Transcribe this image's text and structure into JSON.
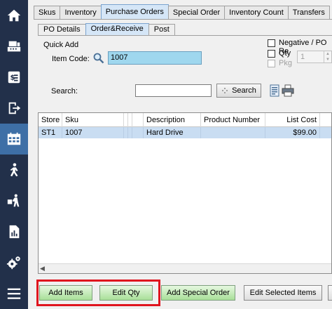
{
  "nav": {
    "items": [
      {
        "icon": "home-icon"
      },
      {
        "icon": "register-icon"
      },
      {
        "icon": "invoice-icon"
      },
      {
        "icon": "sign-out-icon"
      },
      {
        "icon": "calendar-grid-icon",
        "active": true
      },
      {
        "icon": "person-walking-icon"
      },
      {
        "icon": "delivery-icon"
      },
      {
        "icon": "report-icon"
      },
      {
        "icon": "settings-icon"
      },
      {
        "icon": "menu-icon"
      }
    ]
  },
  "tabs": [
    "Skus",
    "Inventory",
    "Purchase Orders",
    "Special Order",
    "Inventory Count",
    "Transfers"
  ],
  "active_tab": "Purchase Orders",
  "subtabs": [
    "PO Details",
    "Order&Receive",
    "Post"
  ],
  "active_subtab": "Order&Receive",
  "quick_add": {
    "title": "Quick Add",
    "item_code_label": "Item Code:",
    "item_code_value": "1007",
    "negative_label": "Negative / PO Re",
    "qty_label": "Qty",
    "pkg_label": "Pkg",
    "qty_value": "1"
  },
  "search": {
    "label": "Search:",
    "value": "",
    "button_label": "Search"
  },
  "grid": {
    "columns": [
      "Store",
      "Sku",
      "",
      "",
      "",
      "Description",
      "Product Number",
      "List Cost"
    ],
    "rows": [
      {
        "store": "ST1",
        "sku": "1007",
        "description": "Hard Drive",
        "product_number": "",
        "list_cost": "$99.00"
      }
    ]
  },
  "buttons": {
    "add_items": "Add Items",
    "edit_qty": "Edit Qty",
    "add_special_order": "Add Special Order",
    "edit_selected_items": "Edit Selected Items"
  },
  "colors": {
    "nav_bg": "#22304a",
    "nav_active": "#3e6fa6",
    "highlight_border": "#e0141e",
    "selected_row": "#c9ddf2",
    "input_highlight": "#9fd7ee"
  }
}
